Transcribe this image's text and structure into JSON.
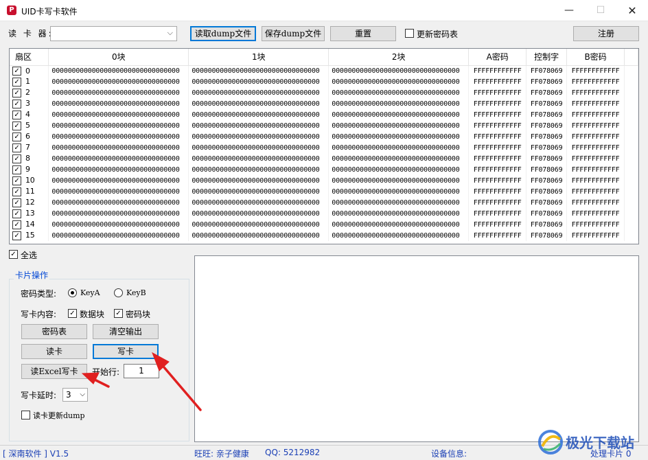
{
  "window": {
    "title": "UID卡写卡软件",
    "icon_letter": "P",
    "min_icon": "minimize-icon",
    "max_icon": "maximize-icon",
    "close_icon": "close-icon"
  },
  "toolbar": {
    "reader_label": "读 卡 器:",
    "reader_value": "",
    "read_dump": "读取dump文件",
    "save_dump": "保存dump文件",
    "reset": "重置",
    "update_key_table": "更新密码表",
    "register": "注册"
  },
  "grid": {
    "columns": [
      "扇区",
      "0块",
      "1块",
      "2块",
      "A密码",
      "控制字",
      "B密码"
    ],
    "rows": [
      {
        "sector": "0",
        "b0": "00000000000000000000000000000000",
        "b1": "00000000000000000000000000000000",
        "b2": "00000000000000000000000000000000",
        "keyA": "FFFFFFFFFFFF",
        "ctrl": "FF078069",
        "keyB": "FFFFFFFFFFFF",
        "checked": true
      },
      {
        "sector": "1",
        "b0": "00000000000000000000000000000000",
        "b1": "00000000000000000000000000000000",
        "b2": "00000000000000000000000000000000",
        "keyA": "FFFFFFFFFFFF",
        "ctrl": "FF078069",
        "keyB": "FFFFFFFFFFFF",
        "checked": true
      },
      {
        "sector": "2",
        "b0": "00000000000000000000000000000000",
        "b1": "00000000000000000000000000000000",
        "b2": "00000000000000000000000000000000",
        "keyA": "FFFFFFFFFFFF",
        "ctrl": "FF078069",
        "keyB": "FFFFFFFFFFFF",
        "checked": true
      },
      {
        "sector": "3",
        "b0": "00000000000000000000000000000000",
        "b1": "00000000000000000000000000000000",
        "b2": "00000000000000000000000000000000",
        "keyA": "FFFFFFFFFFFF",
        "ctrl": "FF078069",
        "keyB": "FFFFFFFFFFFF",
        "checked": true
      },
      {
        "sector": "4",
        "b0": "00000000000000000000000000000000",
        "b1": "00000000000000000000000000000000",
        "b2": "00000000000000000000000000000000",
        "keyA": "FFFFFFFFFFFF",
        "ctrl": "FF078069",
        "keyB": "FFFFFFFFFFFF",
        "checked": true
      },
      {
        "sector": "5",
        "b0": "00000000000000000000000000000000",
        "b1": "00000000000000000000000000000000",
        "b2": "00000000000000000000000000000000",
        "keyA": "FFFFFFFFFFFF",
        "ctrl": "FF078069",
        "keyB": "FFFFFFFFFFFF",
        "checked": true
      },
      {
        "sector": "6",
        "b0": "00000000000000000000000000000000",
        "b1": "00000000000000000000000000000000",
        "b2": "00000000000000000000000000000000",
        "keyA": "FFFFFFFFFFFF",
        "ctrl": "FF078069",
        "keyB": "FFFFFFFFFFFF",
        "checked": true
      },
      {
        "sector": "7",
        "b0": "00000000000000000000000000000000",
        "b1": "00000000000000000000000000000000",
        "b2": "00000000000000000000000000000000",
        "keyA": "FFFFFFFFFFFF",
        "ctrl": "FF078069",
        "keyB": "FFFFFFFFFFFF",
        "checked": true
      },
      {
        "sector": "8",
        "b0": "00000000000000000000000000000000",
        "b1": "00000000000000000000000000000000",
        "b2": "00000000000000000000000000000000",
        "keyA": "FFFFFFFFFFFF",
        "ctrl": "FF078069",
        "keyB": "FFFFFFFFFFFF",
        "checked": true
      },
      {
        "sector": "9",
        "b0": "00000000000000000000000000000000",
        "b1": "00000000000000000000000000000000",
        "b2": "00000000000000000000000000000000",
        "keyA": "FFFFFFFFFFFF",
        "ctrl": "FF078069",
        "keyB": "FFFFFFFFFFFF",
        "checked": true
      },
      {
        "sector": "10",
        "b0": "00000000000000000000000000000000",
        "b1": "00000000000000000000000000000000",
        "b2": "00000000000000000000000000000000",
        "keyA": "FFFFFFFFFFFF",
        "ctrl": "FF078069",
        "keyB": "FFFFFFFFFFFF",
        "checked": true
      },
      {
        "sector": "11",
        "b0": "00000000000000000000000000000000",
        "b1": "00000000000000000000000000000000",
        "b2": "00000000000000000000000000000000",
        "keyA": "FFFFFFFFFFFF",
        "ctrl": "FF078069",
        "keyB": "FFFFFFFFFFFF",
        "checked": true
      },
      {
        "sector": "12",
        "b0": "00000000000000000000000000000000",
        "b1": "00000000000000000000000000000000",
        "b2": "00000000000000000000000000000000",
        "keyA": "FFFFFFFFFFFF",
        "ctrl": "FF078069",
        "keyB": "FFFFFFFFFFFF",
        "checked": true
      },
      {
        "sector": "13",
        "b0": "00000000000000000000000000000000",
        "b1": "00000000000000000000000000000000",
        "b2": "00000000000000000000000000000000",
        "keyA": "FFFFFFFFFFFF",
        "ctrl": "FF078069",
        "keyB": "FFFFFFFFFFFF",
        "checked": true
      },
      {
        "sector": "14",
        "b0": "00000000000000000000000000000000",
        "b1": "00000000000000000000000000000000",
        "b2": "00000000000000000000000000000000",
        "keyA": "FFFFFFFFFFFF",
        "ctrl": "FF078069",
        "keyB": "FFFFFFFFFFFF",
        "checked": true
      },
      {
        "sector": "15",
        "b0": "00000000000000000000000000000000",
        "b1": "00000000000000000000000000000000",
        "b2": "00000000000000000000000000000000",
        "keyA": "FFFFFFFFFFFF",
        "ctrl": "FF078069",
        "keyB": "FFFFFFFFFFFF",
        "checked": true
      }
    ]
  },
  "select_all": {
    "label": "全选",
    "checked": true
  },
  "card_ops": {
    "title": "卡片操作",
    "key_type_label": "密码类型:",
    "key_a": "KeyA",
    "key_b": "KeyB",
    "key_a_selected": true,
    "write_content_label": "写卡内容:",
    "data_block": "数据块",
    "key_block": "密码块",
    "key_table_btn": "密码表",
    "clear_output_btn": "清空输出",
    "read_card_btn": "读卡",
    "write_card_btn": "写卡",
    "read_excel_btn": "读Excel写卡",
    "start_row_label": "开始行:",
    "start_row_value": "1",
    "delay_label": "写卡延时:",
    "delay_value": "3",
    "read_update_dump": "读卡更新dump"
  },
  "status": {
    "vendor": "[ 深南软件 ]  V1.5",
    "wangwang": "旺旺:  亲子健康",
    "qq": "QQ:  5212982",
    "device_info": "设备信息:",
    "processed": "处理卡片  0"
  },
  "watermark": {
    "text": "极光下载站"
  },
  "colors": {
    "accent": "#0078d7",
    "status_text": "#1a3fb5",
    "group_title": "#0046d5",
    "arrow": "#e02020"
  }
}
